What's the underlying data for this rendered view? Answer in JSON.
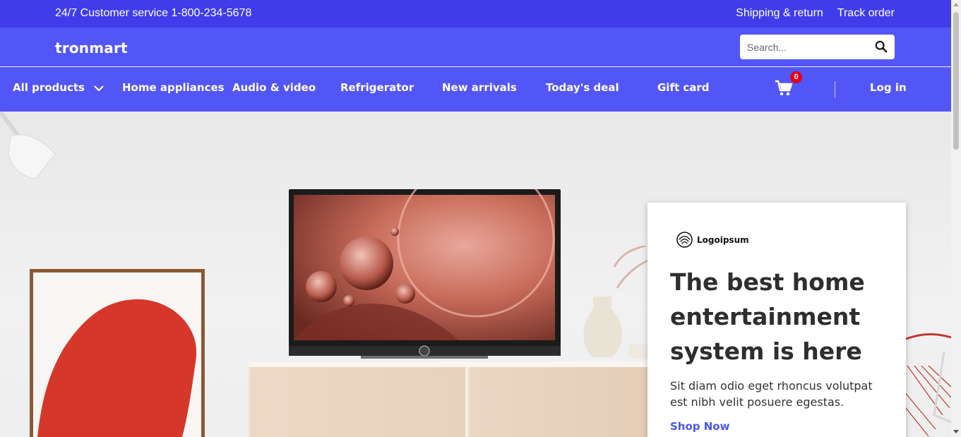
{
  "topbar": {
    "service": "24/7 Customer service 1-800-234-5678",
    "links": [
      "Shipping & return",
      "Track order"
    ]
  },
  "header": {
    "brand": "tronmart",
    "search": {
      "placeholder": "Search...",
      "value": ""
    }
  },
  "nav": {
    "items": [
      "All products",
      "Home appliances",
      "Audio & video",
      "Refrigerator",
      "New arrivals",
      "Today's deal",
      "Gift card"
    ],
    "cart_count": "0",
    "login": "Log in"
  },
  "hero": {
    "logo_text": "Logoipsum",
    "headline": "The best home entertainment system is here",
    "description": "Sit diam odio eget rhoncus volutpat est nibh velit posuere egestas.",
    "cta": "Shop Now"
  },
  "colors": {
    "topbar": "#3f3de9",
    "nav": "#5356f7",
    "accent": "#4a55e8",
    "badge": "#e3001b"
  },
  "icons": {
    "search": "search-icon",
    "cart": "cart-icon",
    "chevron": "chevron-down-icon"
  }
}
